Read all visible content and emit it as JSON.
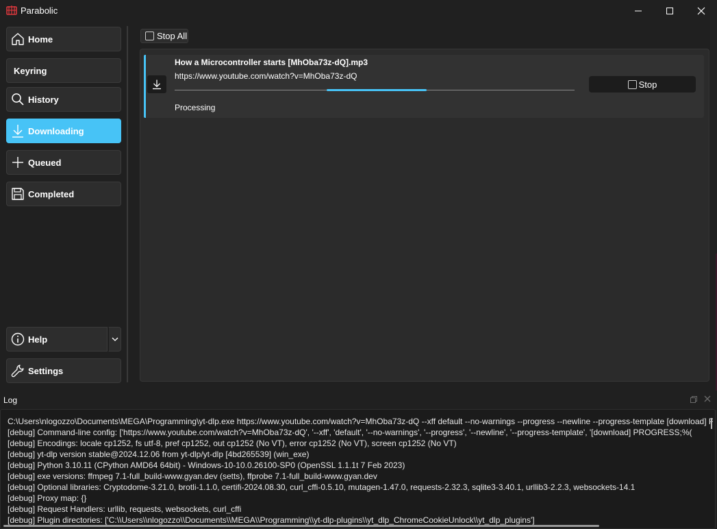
{
  "window": {
    "title": "Parabolic",
    "accent_color": "#47c3f6"
  },
  "sidebar": {
    "items": [
      {
        "label": "Home",
        "icon": "home-icon"
      },
      {
        "label": "Keyring",
        "icon": ""
      },
      {
        "label": "History",
        "icon": "search-icon"
      },
      {
        "label": "Downloading",
        "icon": "download-icon",
        "active": true
      },
      {
        "label": "Queued",
        "icon": "plus-icon"
      },
      {
        "label": "Completed",
        "icon": "save-icon"
      }
    ],
    "help_label": "Help",
    "settings_label": "Settings"
  },
  "main": {
    "stop_all_label": "Stop All",
    "download": {
      "title": "How a Microcontroller starts [MhOba73z-dQ].mp3",
      "url": "https://www.youtube.com/watch?v=MhOba73z-dQ",
      "status": "Processing",
      "stop_label": "Stop",
      "progress": "indeterminate"
    }
  },
  "log": {
    "title": "Log",
    "lines": [
      "C:\\Users\\nlogozzo\\Documents\\MEGA\\Programming\\yt-dlp.exe https://www.youtube.com/watch?v=MhOba73z-dQ --xff default --no-warnings --progress --newline --progress-template [download] PROGRESS;%(",
      "[debug] Command-line config: ['https://www.youtube.com/watch?v=MhOba73z-dQ', '--xff', 'default', '--no-warnings', '--progress', '--newline', '--progress-template', '[download] PROGRESS;%(",
      "[debug] Encodings: locale cp1252, fs utf-8, pref cp1252, out cp1252 (No VT), error cp1252 (No VT), screen cp1252 (No VT)",
      "[debug] yt-dlp version stable@2024.12.06 from yt-dlp/yt-dlp [4bd265539] (win_exe)",
      "[debug] Python 3.10.11 (CPython AMD64 64bit) - Windows-10-10.0.26100-SP0 (OpenSSL 1.1.1t  7 Feb 2023)",
      "[debug] exe versions: ffmpeg 7.1-full_build-www.gyan.dev (setts), ffprobe 7.1-full_build-www.gyan.dev",
      "[debug] Optional libraries: Cryptodome-3.21.0, brotli-1.1.0, certifi-2024.08.30, curl_cffi-0.5.10, mutagen-1.47.0, requests-2.32.3, sqlite3-3.40.1, urllib3-2.2.3, websockets-14.1",
      "[debug] Proxy map: {}",
      "[debug] Request Handlers: urllib, requests, websockets, curl_cffi",
      "[debug] Plugin directories: ['C:\\\\Users\\\\nlogozzo\\\\Documents\\\\MEGA\\\\Programming\\\\yt-dlp-plugins\\\\yt_dlp_ChromeCookieUnlock\\\\yt_dlp_plugins']"
    ]
  }
}
